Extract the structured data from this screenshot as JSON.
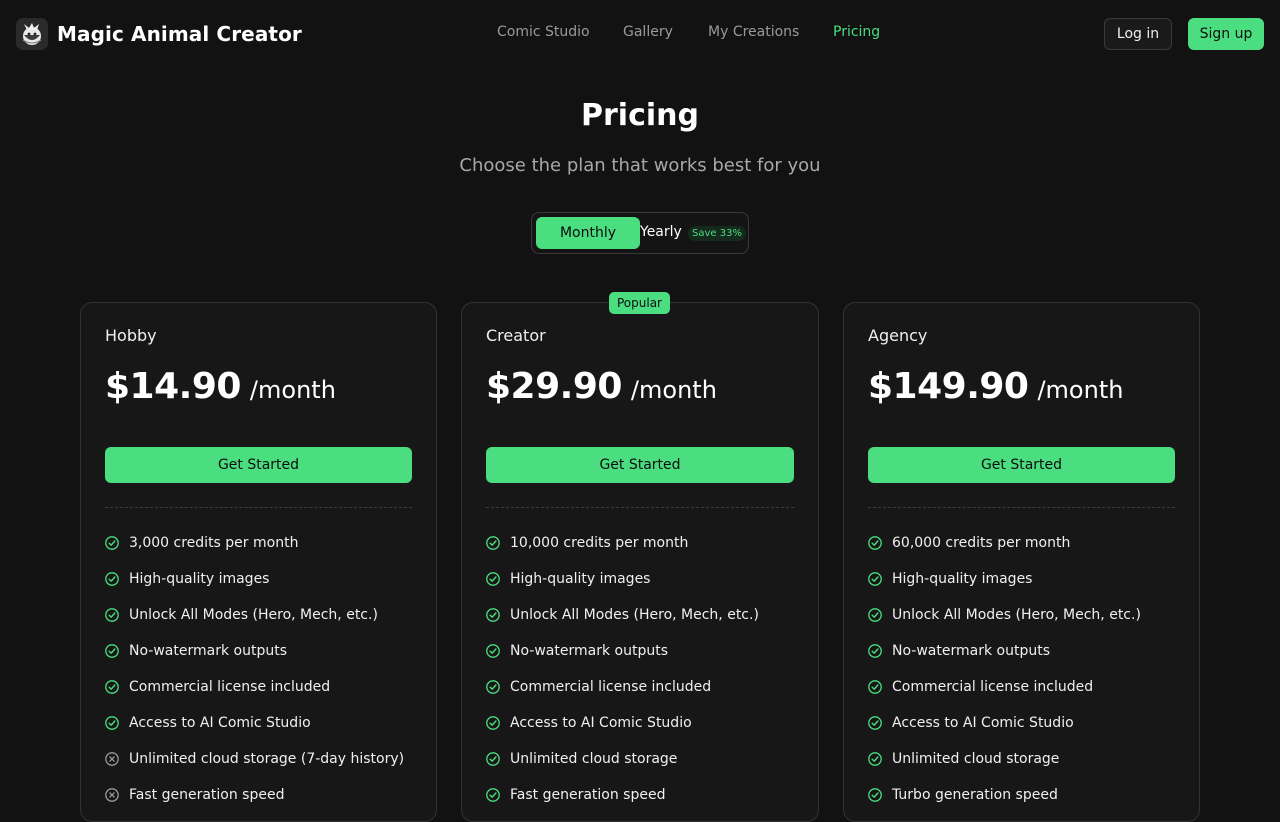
{
  "brand": {
    "name": "Magic Animal Creator",
    "logo_icon": "dragon-logo-icon"
  },
  "nav": {
    "items": [
      {
        "label": "Comic Studio",
        "active": false
      },
      {
        "label": "Gallery",
        "active": false
      },
      {
        "label": "My Creations",
        "active": false
      },
      {
        "label": "Pricing",
        "active": true
      }
    ]
  },
  "auth": {
    "login": "Log in",
    "signup": "Sign up"
  },
  "hero": {
    "title": "Pricing",
    "subtitle": "Choose the plan that works best for you"
  },
  "billing": {
    "monthly": "Monthly",
    "yearly": "Yearly",
    "save_badge": "Save 33%",
    "selected": "Monthly"
  },
  "colors": {
    "accent": "#4ade80",
    "background": "#121212",
    "card": "#171717",
    "check": "#4ade80",
    "cross": "#9a9a9a"
  },
  "plans": [
    {
      "name": "Hobby",
      "price": "$14.90",
      "period": "/month",
      "cta": "Get Started",
      "badge": "",
      "features": [
        {
          "text": "3,000 credits per month",
          "included": true
        },
        {
          "text": "High-quality images",
          "included": true
        },
        {
          "text": "Unlock All Modes (Hero, Mech, etc.)",
          "included": true
        },
        {
          "text": "No-watermark outputs",
          "included": true
        },
        {
          "text": "Commercial license included",
          "included": true
        },
        {
          "text": "Access to AI Comic Studio",
          "included": true
        },
        {
          "text": "Unlimited cloud storage (7-day history)",
          "included": false
        },
        {
          "text": "Fast generation speed",
          "included": false
        }
      ]
    },
    {
      "name": "Creator",
      "price": "$29.90",
      "period": "/month",
      "cta": "Get Started",
      "badge": "Popular",
      "features": [
        {
          "text": "10,000 credits per month",
          "included": true
        },
        {
          "text": "High-quality images",
          "included": true
        },
        {
          "text": "Unlock All Modes (Hero, Mech, etc.)",
          "included": true
        },
        {
          "text": "No-watermark outputs",
          "included": true
        },
        {
          "text": "Commercial license included",
          "included": true
        },
        {
          "text": "Access to AI Comic Studio",
          "included": true
        },
        {
          "text": "Unlimited cloud storage",
          "included": true
        },
        {
          "text": "Fast generation speed",
          "included": true
        }
      ]
    },
    {
      "name": "Agency",
      "price": "$149.90",
      "period": "/month",
      "cta": "Get Started",
      "badge": "",
      "features": [
        {
          "text": "60,000 credits per month",
          "included": true
        },
        {
          "text": "High-quality images",
          "included": true
        },
        {
          "text": "Unlock All Modes (Hero, Mech, etc.)",
          "included": true
        },
        {
          "text": "No-watermark outputs",
          "included": true
        },
        {
          "text": "Commercial license included",
          "included": true
        },
        {
          "text": "Access to AI Comic Studio",
          "included": true
        },
        {
          "text": "Unlimited cloud storage",
          "included": true
        },
        {
          "text": "Turbo generation speed",
          "included": true
        }
      ]
    }
  ]
}
